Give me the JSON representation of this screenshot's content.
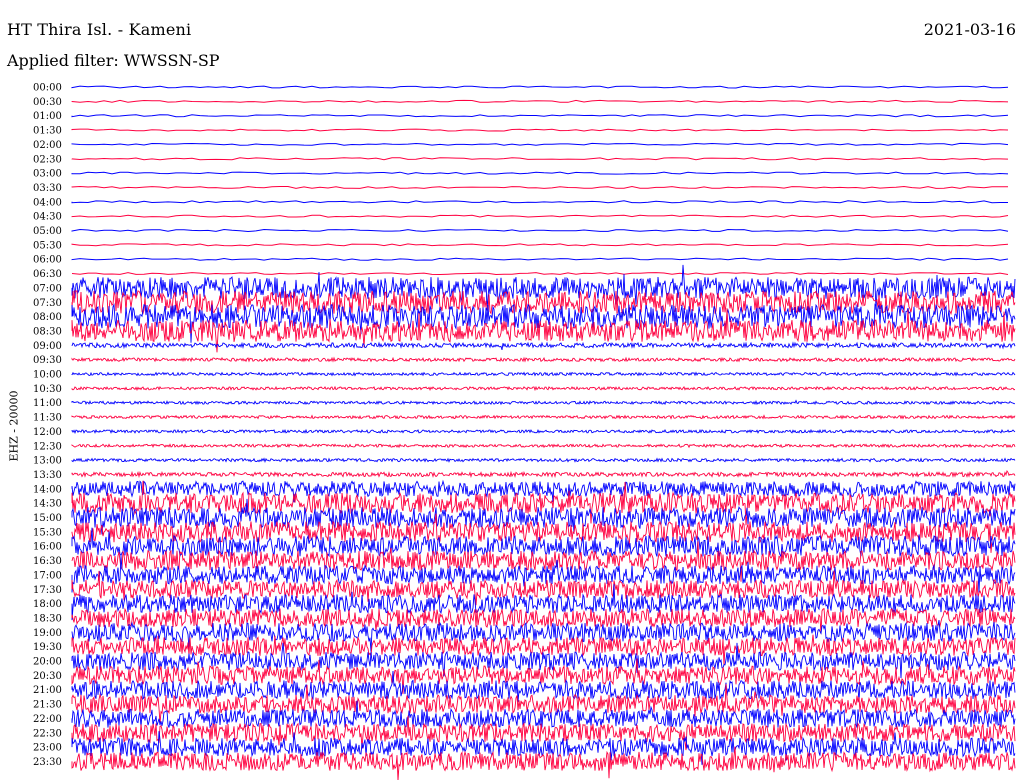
{
  "header": {
    "station": "HT Thira Isl. - Kameni",
    "date": "2021-03-16",
    "filter": "Applied filter: WWSSN-SP"
  },
  "colors": {
    "trace_a": "#0000ff",
    "trace_b": "#ff0040",
    "text": "#000000"
  },
  "chart_data": {
    "type": "line",
    "subtype": "helicorder",
    "ylabel": "EHZ - 20000",
    "xlabel": "",
    "grid": false,
    "legend": "none",
    "minutes_per_line": 30,
    "rows": [
      {
        "label": "00:00",
        "activity": 0.0,
        "color": "blue"
      },
      {
        "label": "00:30",
        "activity": 0.0,
        "color": "red"
      },
      {
        "label": "01:00",
        "activity": 0.0,
        "color": "blue"
      },
      {
        "label": "01:30",
        "activity": 0.0,
        "color": "red"
      },
      {
        "label": "02:00",
        "activity": 0.0,
        "color": "blue"
      },
      {
        "label": "02:30",
        "activity": 0.0,
        "color": "red"
      },
      {
        "label": "03:00",
        "activity": 0.0,
        "color": "blue"
      },
      {
        "label": "03:30",
        "activity": 0.0,
        "color": "red"
      },
      {
        "label": "04:00",
        "activity": 0.0,
        "color": "blue"
      },
      {
        "label": "04:30",
        "activity": 0.0,
        "color": "red"
      },
      {
        "label": "05:00",
        "activity": 0.0,
        "color": "blue"
      },
      {
        "label": "05:30",
        "activity": 0.0,
        "color": "red"
      },
      {
        "label": "06:00",
        "activity": 0.0,
        "color": "blue"
      },
      {
        "label": "06:30",
        "activity": 0.0,
        "color": "red"
      },
      {
        "label": "07:00",
        "activity": 0.9,
        "color": "blue"
      },
      {
        "label": "07:30",
        "activity": 0.95,
        "color": "red"
      },
      {
        "label": "08:00",
        "activity": 1.0,
        "color": "blue"
      },
      {
        "label": "08:30",
        "activity": 0.9,
        "color": "red"
      },
      {
        "label": "09:00",
        "activity": 0.12,
        "color": "blue"
      },
      {
        "label": "09:30",
        "activity": 0.06,
        "color": "red"
      },
      {
        "label": "10:00",
        "activity": 0.04,
        "color": "blue"
      },
      {
        "label": "10:30",
        "activity": 0.04,
        "color": "red"
      },
      {
        "label": "11:00",
        "activity": 0.04,
        "color": "blue"
      },
      {
        "label": "11:30",
        "activity": 0.04,
        "color": "red"
      },
      {
        "label": "12:00",
        "activity": 0.04,
        "color": "blue"
      },
      {
        "label": "12:30",
        "activity": 0.04,
        "color": "red"
      },
      {
        "label": "13:00",
        "activity": 0.05,
        "color": "blue"
      },
      {
        "label": "13:30",
        "activity": 0.1,
        "color": "red"
      },
      {
        "label": "14:00",
        "activity": 0.6,
        "color": "blue"
      },
      {
        "label": "14:30",
        "activity": 0.85,
        "color": "red"
      },
      {
        "label": "15:00",
        "activity": 0.85,
        "color": "blue"
      },
      {
        "label": "15:30",
        "activity": 0.85,
        "color": "red"
      },
      {
        "label": "16:00",
        "activity": 0.85,
        "color": "blue"
      },
      {
        "label": "16:30",
        "activity": 0.8,
        "color": "red"
      },
      {
        "label": "17:00",
        "activity": 0.75,
        "color": "blue"
      },
      {
        "label": "17:30",
        "activity": 0.75,
        "color": "red"
      },
      {
        "label": "18:00",
        "activity": 0.75,
        "color": "blue"
      },
      {
        "label": "18:30",
        "activity": 0.75,
        "color": "red"
      },
      {
        "label": "19:00",
        "activity": 0.75,
        "color": "blue"
      },
      {
        "label": "19:30",
        "activity": 0.75,
        "color": "red"
      },
      {
        "label": "20:00",
        "activity": 0.75,
        "color": "blue"
      },
      {
        "label": "20:30",
        "activity": 0.75,
        "color": "red"
      },
      {
        "label": "21:00",
        "activity": 0.75,
        "color": "blue"
      },
      {
        "label": "21:30",
        "activity": 0.75,
        "color": "red"
      },
      {
        "label": "22:00",
        "activity": 0.75,
        "color": "blue"
      },
      {
        "label": "22:30",
        "activity": 0.75,
        "color": "red"
      },
      {
        "label": "23:00",
        "activity": 0.75,
        "color": "blue"
      },
      {
        "label": "23:30",
        "activity": 0.75,
        "color": "red"
      }
    ]
  }
}
